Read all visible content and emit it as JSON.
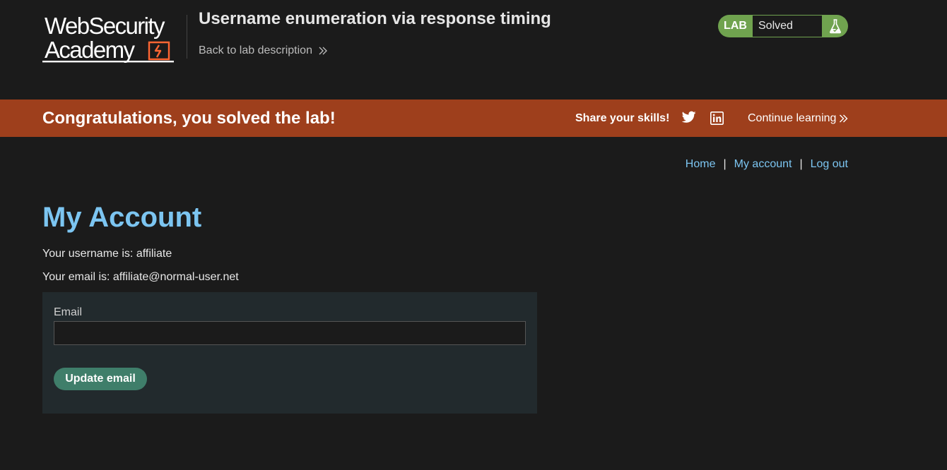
{
  "header": {
    "logo_line1": "WebSecurity",
    "logo_line2": "Academy",
    "lab_title": "Username enumeration via response timing",
    "back_link": "Back to lab description",
    "lab_badge": {
      "label": "LAB",
      "status": "Solved"
    }
  },
  "banner": {
    "message": "Congratulations, you solved the lab!",
    "share_label": "Share your skills!",
    "continue_label": "Continue learning"
  },
  "nav": {
    "home": "Home",
    "separator": "|",
    "my_account": "My account",
    "log_out": "Log out"
  },
  "main": {
    "title": "My Account",
    "username_line": "Your username is: affiliate",
    "email_line": "Your email is: affiliate@normal-user.net",
    "form": {
      "email_label": "Email",
      "email_value": "",
      "submit_label": "Update email"
    }
  },
  "colors": {
    "background": "#1b1b1b",
    "banner": "#9e3f1c",
    "accent_link": "#7cc5f1",
    "badge_green": "#70a34f",
    "button": "#3f7e6a",
    "panel": "#222a2d"
  },
  "icons": [
    "logo-bolt-icon",
    "double-chevron-right-icon",
    "flask-icon",
    "twitter-icon",
    "linkedin-icon"
  ]
}
